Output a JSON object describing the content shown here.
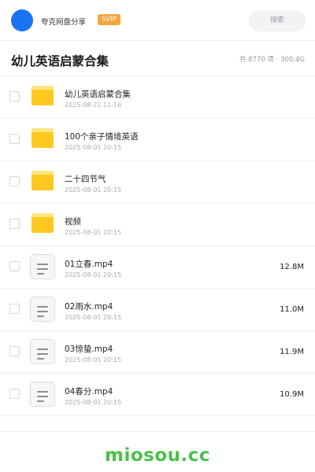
{
  "header": {
    "app_name": "夸克网盘分享",
    "badge": "SVIP",
    "search_placeholder": "搜索",
    "avatar_color": "#1a73f5",
    "badge_color": "#f4a53c"
  },
  "folder": {
    "title": "幼儿英语启蒙合集",
    "meta": "共 8770 项 · 300.4G"
  },
  "files": [
    {
      "name": "幼儿英语启蒙合集",
      "date": "2025-08-21 11:16",
      "type": "folder",
      "size": ""
    },
    {
      "name": "100个亲子情境英语",
      "date": "2025-08-01 20:15",
      "type": "folder",
      "size": ""
    },
    {
      "name": "二十四节气",
      "date": "2025-08-01 20:15",
      "type": "folder",
      "size": ""
    },
    {
      "name": "视频",
      "date": "2025-08-01 20:15",
      "type": "folder",
      "size": ""
    },
    {
      "name": "01立春.mp4",
      "date": "2025-08-01 20:15",
      "type": "file",
      "size": "12.8M"
    },
    {
      "name": "02雨水.mp4",
      "date": "2025-08-01 20:15",
      "type": "file",
      "size": "11.0M"
    },
    {
      "name": "03惊蛰.mp4",
      "date": "2025-08-01 20:15",
      "type": "file",
      "size": "11.9M"
    },
    {
      "name": "04春分.mp4",
      "date": "2025-08-01 20:15",
      "type": "file",
      "size": "10.9M"
    }
  ],
  "watermark": "miosou.cc",
  "colors": {
    "folder": "#ffc820",
    "watermark": "#4cbf4c"
  }
}
